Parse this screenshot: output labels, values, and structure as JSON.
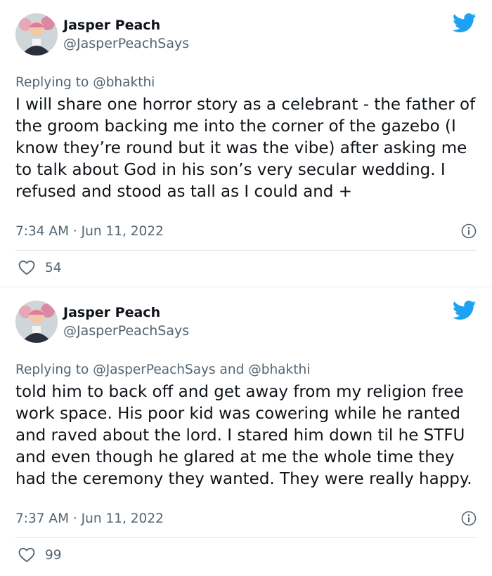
{
  "tweets": [
    {
      "display_name": "Jasper Peach",
      "handle": "@JasperPeachSays",
      "reply_prefix": "Replying to ",
      "reply_mentions": "@bhakthi",
      "reply_joiner": "",
      "reply_mentions2": "",
      "text": "I will share one horror story as a celebrant - the father of the groom backing me into the corner of the gazebo (I know they’re round but it was the vibe) after asking me to talk about God in his son’s very secular wedding. I refused and stood as tall as I could and +",
      "timestamp": "7:34 AM · Jun 11, 2022",
      "likes": "54",
      "icons": [
        "twitter-bird-icon",
        "info-icon",
        "heart-icon"
      ]
    },
    {
      "display_name": "Jasper Peach",
      "handle": "@JasperPeachSays",
      "reply_prefix": "Replying to ",
      "reply_mentions": "@JasperPeachSays",
      "reply_joiner": " and ",
      "reply_mentions2": "@bhakthi",
      "text": "told him to back off and get away from my religion free work space. His poor kid was cowering while he ranted and raved about the lord. I stared him down til he STFU and even though he glared at me the whole time they had the ceremony they wanted. They were really happy.",
      "timestamp": "7:37 AM · Jun 11, 2022",
      "likes": "99",
      "icons": [
        "twitter-bird-icon",
        "info-icon",
        "heart-icon"
      ]
    }
  ],
  "colors": {
    "twitter_blue": "#1da1f2",
    "secondary_text": "#536471",
    "primary_text": "#0f1419",
    "divider": "#e1e8ed"
  }
}
